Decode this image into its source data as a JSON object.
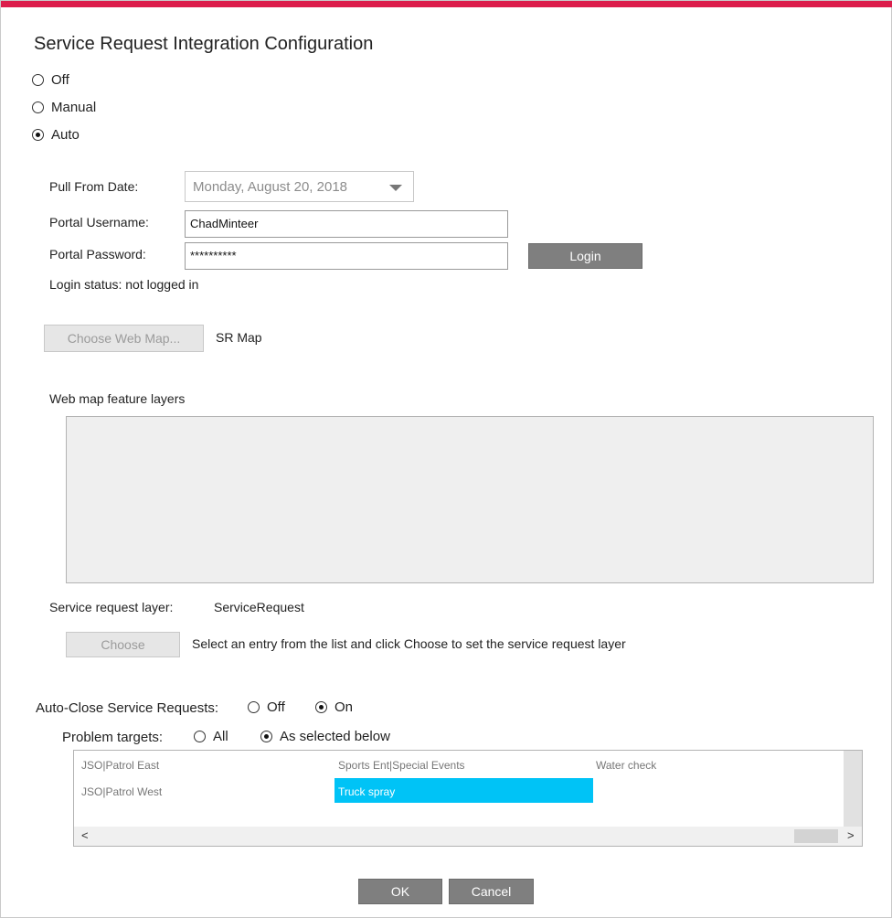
{
  "dialog": {
    "title": "Service Request Integration Configuration"
  },
  "mode": {
    "options": [
      {
        "label": "Off",
        "checked": false
      },
      {
        "label": "Manual",
        "checked": false
      },
      {
        "label": "Auto",
        "checked": true
      }
    ]
  },
  "form": {
    "pull_from_date_label": "Pull From Date:",
    "pull_from_date_value": "Monday, August 20, 2018",
    "username_label": "Portal Username:",
    "username_value": "ChadMinteer",
    "password_label": "Portal Password:",
    "password_value": "**********",
    "login_button": "Login",
    "login_status": "Login status: not logged in"
  },
  "web_map": {
    "choose_button": "Choose Web Map...",
    "selected_map": "SR Map",
    "feature_layers_label": "Web map feature layers"
  },
  "service_request_layer": {
    "label": "Service request layer:",
    "value": "ServiceRequest",
    "choose_button": "Choose",
    "hint": "Select an entry from the list and click Choose to set the service request layer"
  },
  "auto_close": {
    "label": "Auto-Close Service Requests:",
    "options": [
      {
        "label": "Off",
        "checked": false
      },
      {
        "label": "On",
        "checked": true
      }
    ]
  },
  "problem_targets": {
    "label": "Problem targets:",
    "options": [
      {
        "label": "All",
        "checked": false
      },
      {
        "label": "As selected below",
        "checked": true
      }
    ],
    "items": [
      {
        "label": "JSO|Patrol East",
        "selected": false
      },
      {
        "label": "JSO|Patrol West",
        "selected": false
      },
      {
        "label": "Sports Ent|Special Events",
        "selected": false
      },
      {
        "label": "Truck spray",
        "selected": true
      },
      {
        "label": "Water check",
        "selected": false
      }
    ],
    "scroll_left": "<",
    "scroll_right": ">"
  },
  "footer": {
    "ok_button": "OK",
    "cancel_button": "Cancel"
  },
  "colors": {
    "accent": "#dc1d4b",
    "selection": "#00c3f6",
    "button": "#7f7f7f"
  }
}
